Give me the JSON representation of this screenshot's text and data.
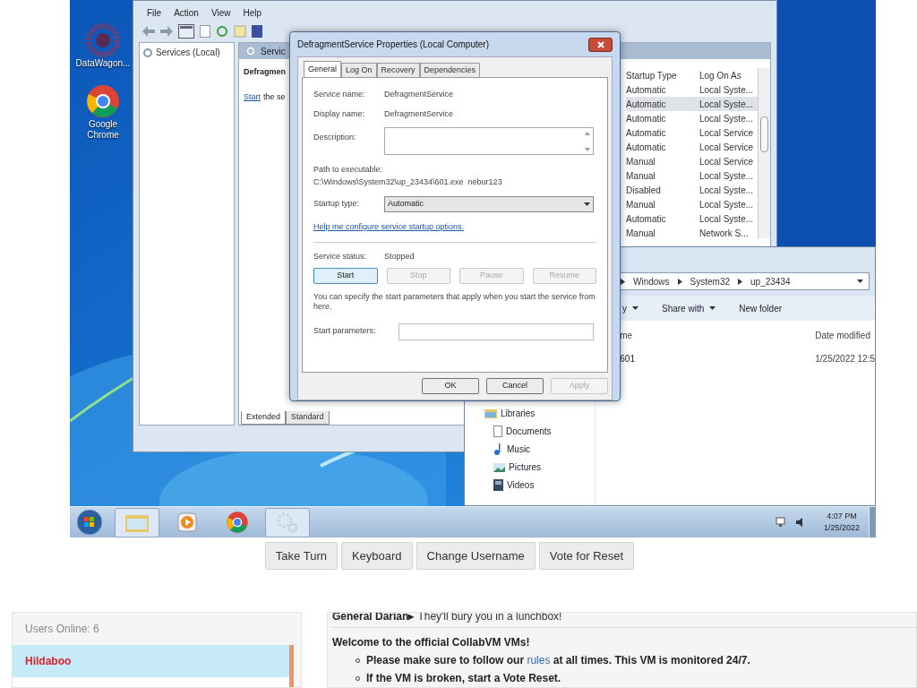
{
  "desktop_icons": [
    {
      "kind": "wagon",
      "label": "DataWagon..."
    },
    {
      "kind": "chrome",
      "label": "Google Chrome"
    }
  ],
  "services_window": {
    "menu": [
      "File",
      "Action",
      "View",
      "Help"
    ],
    "tree_item": "Services (Local)",
    "pane_header": "Servic",
    "service_title": "Defragmen",
    "start_link": "Start",
    "start_rest": "the se",
    "columns": [
      "Startup Type",
      "Log On As"
    ],
    "rows": [
      {
        "startup": "Automatic",
        "logon": "Local Syste...",
        "selected": false
      },
      {
        "startup": "Automatic",
        "logon": "Local Syste...",
        "selected": true
      },
      {
        "startup": "Automatic",
        "logon": "Local Syste...",
        "selected": false
      },
      {
        "startup": "Automatic",
        "logon": "Local Service",
        "selected": false
      },
      {
        "startup": "Automatic",
        "logon": "Local Service",
        "selected": false
      },
      {
        "startup": "Manual",
        "logon": "Local Service",
        "selected": false
      },
      {
        "startup": "Manual",
        "logon": "Local Syste...",
        "selected": false
      },
      {
        "startup": "Disabled",
        "logon": "Local Syste...",
        "selected": false
      },
      {
        "startup": "Manual",
        "logon": "Local Syste...",
        "selected": false
      },
      {
        "startup": "Automatic",
        "logon": "Local Syste...",
        "selected": false
      },
      {
        "startup": "Manual",
        "logon": "Network S...",
        "selected": false
      }
    ],
    "view_tabs": [
      {
        "label": "Extended",
        "selected": true
      },
      {
        "label": "Standard",
        "selected": false
      }
    ]
  },
  "dialog": {
    "title": "DefragmentService Properties (Local Computer)",
    "tabs": [
      {
        "label": "General",
        "selected": true
      },
      {
        "label": "Log On",
        "selected": false
      },
      {
        "label": "Recovery",
        "selected": false
      },
      {
        "label": "Dependencies",
        "selected": false
      }
    ],
    "service_name_label": "Service name:",
    "service_name": "DefragmentService",
    "display_name_label": "Display name:",
    "display_name": "DefragmentService",
    "description_label": "Description:",
    "path_label": "Path to executable:",
    "path": "C:\\Windows\\System32\\up_23434\\601.exe  nebur123",
    "startup_label": "Startup type:",
    "startup_value": "Automatic",
    "help_link": "Help me configure service startup options.",
    "status_label": "Service status:",
    "status": "Stopped",
    "control_buttons": [
      {
        "label": "Start",
        "disabled": false
      },
      {
        "label": "Stop",
        "disabled": true
      },
      {
        "label": "Pause",
        "disabled": true
      },
      {
        "label": "Resume",
        "disabled": true
      }
    ],
    "params_note": "You can specify the start parameters that apply when you start the service from here.",
    "params_label": "Start parameters:",
    "buttons": [
      {
        "label": "OK",
        "disabled": false
      },
      {
        "label": "Cancel",
        "disabled": false
      },
      {
        "label": "Apply",
        "disabled": true
      }
    ]
  },
  "explorer": {
    "breadcrumb": [
      "Windows",
      "System32",
      "up_23434"
    ],
    "toolbar": [
      {
        "label": "y",
        "menu": true
      },
      {
        "label": "Share with",
        "menu": true
      },
      {
        "label": "New folder",
        "menu": false
      }
    ],
    "columns": [
      "me",
      "Date modified"
    ],
    "files": [
      {
        "name": "601",
        "date": "1/25/2022 12:5"
      }
    ],
    "nav": [
      {
        "label": "Libraries",
        "kind": "libraries",
        "children": [
          {
            "label": "Documents",
            "kind": "documents"
          },
          {
            "label": "Music",
            "kind": "music"
          },
          {
            "label": "Pictures",
            "kind": "pictures"
          },
          {
            "label": "Videos",
            "kind": "videos"
          }
        ]
      }
    ]
  },
  "taskbar": {
    "items": [
      {
        "kind": "explorer",
        "selected": true
      },
      {
        "kind": "media",
        "selected": false
      },
      {
        "kind": "chrome",
        "selected": false
      },
      {
        "kind": "services",
        "selected": true
      }
    ],
    "time": "4:07 PM",
    "date": "1/25/2022"
  },
  "vm_buttons": [
    "Take Turn",
    "Keyboard",
    "Change Username",
    "Vote for Reset"
  ],
  "users": {
    "title": "Users Online: 6",
    "list": [
      {
        "name": "Hildaboo",
        "selected": true
      }
    ]
  },
  "chat": {
    "messages": [
      {
        "user": "General Darian▸",
        "text": "They'll bury you in a lunchbox!"
      }
    ],
    "welcome": "Welcome to the official CollabVM VMs!",
    "bullets": [
      {
        "before": "Please make sure to follow our ",
        "link": "rules",
        "after": " at all times. This VM is monitored 24/7."
      },
      {
        "before": "If the VM is broken, start a Vote Reset."
      }
    ]
  }
}
